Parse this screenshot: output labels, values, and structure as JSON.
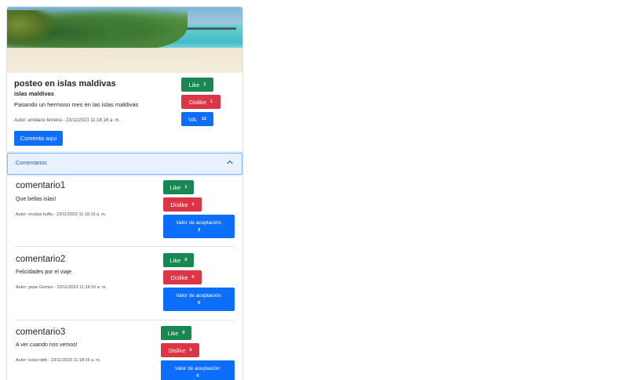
{
  "post": {
    "title": "posteo en islas maldivas",
    "subtitle": "islas maldivas",
    "text": "Pasando un hermoso mes en las islas maldivas",
    "author": "Autor: emiliano ferreira - 23/11/2023 11:18:16 a. m.",
    "like_label": "Like",
    "like_count": "1",
    "dislike_label": "Dislike",
    "dislike_count": "1",
    "va_label": "VA:",
    "va_value": "13",
    "comment_button": "Comenta aqui"
  },
  "accordion": {
    "title": "Comentarios"
  },
  "comments": [
    {
      "title": "comentario1",
      "text": "Que bellas islas!",
      "author": "Autor: nicolas buffa - 23/11/2023 11:18:16 a. m.",
      "like_label": "Like",
      "like_count": "1",
      "dislike_label": "Dislike",
      "dislike_count": "1",
      "va_label": "Valor de aceptación:",
      "va_value": "3"
    },
    {
      "title": "comentario2",
      "text": "Felicidades por el viaje",
      "author": "Autor: pepe Gomez - 23/11/2023 11:18:16 a. m.",
      "like_label": "Like",
      "like_count": "0",
      "dislike_label": "Dislike",
      "dislike_count": "0",
      "va_label": "Valor de aceptación:",
      "va_value": "0"
    },
    {
      "title": "comentario3",
      "text": "A ver cuando nos vemos!",
      "author": "Autor: luisa robb - 23/11/2023 11:18:16 a. m.",
      "like_label": "Like",
      "like_count": "0",
      "dislike_label": "Dislike",
      "dislike_count": "0",
      "va_label": "Valor de aceptación:",
      "va_value": "0"
    }
  ],
  "colors": {
    "like": "#198754",
    "dislike": "#dc3545",
    "primary": "#0d6efd",
    "accordion_bg": "#e7f1ff"
  },
  "icons": {
    "accordion_toggle": "chevron-up-icon"
  }
}
